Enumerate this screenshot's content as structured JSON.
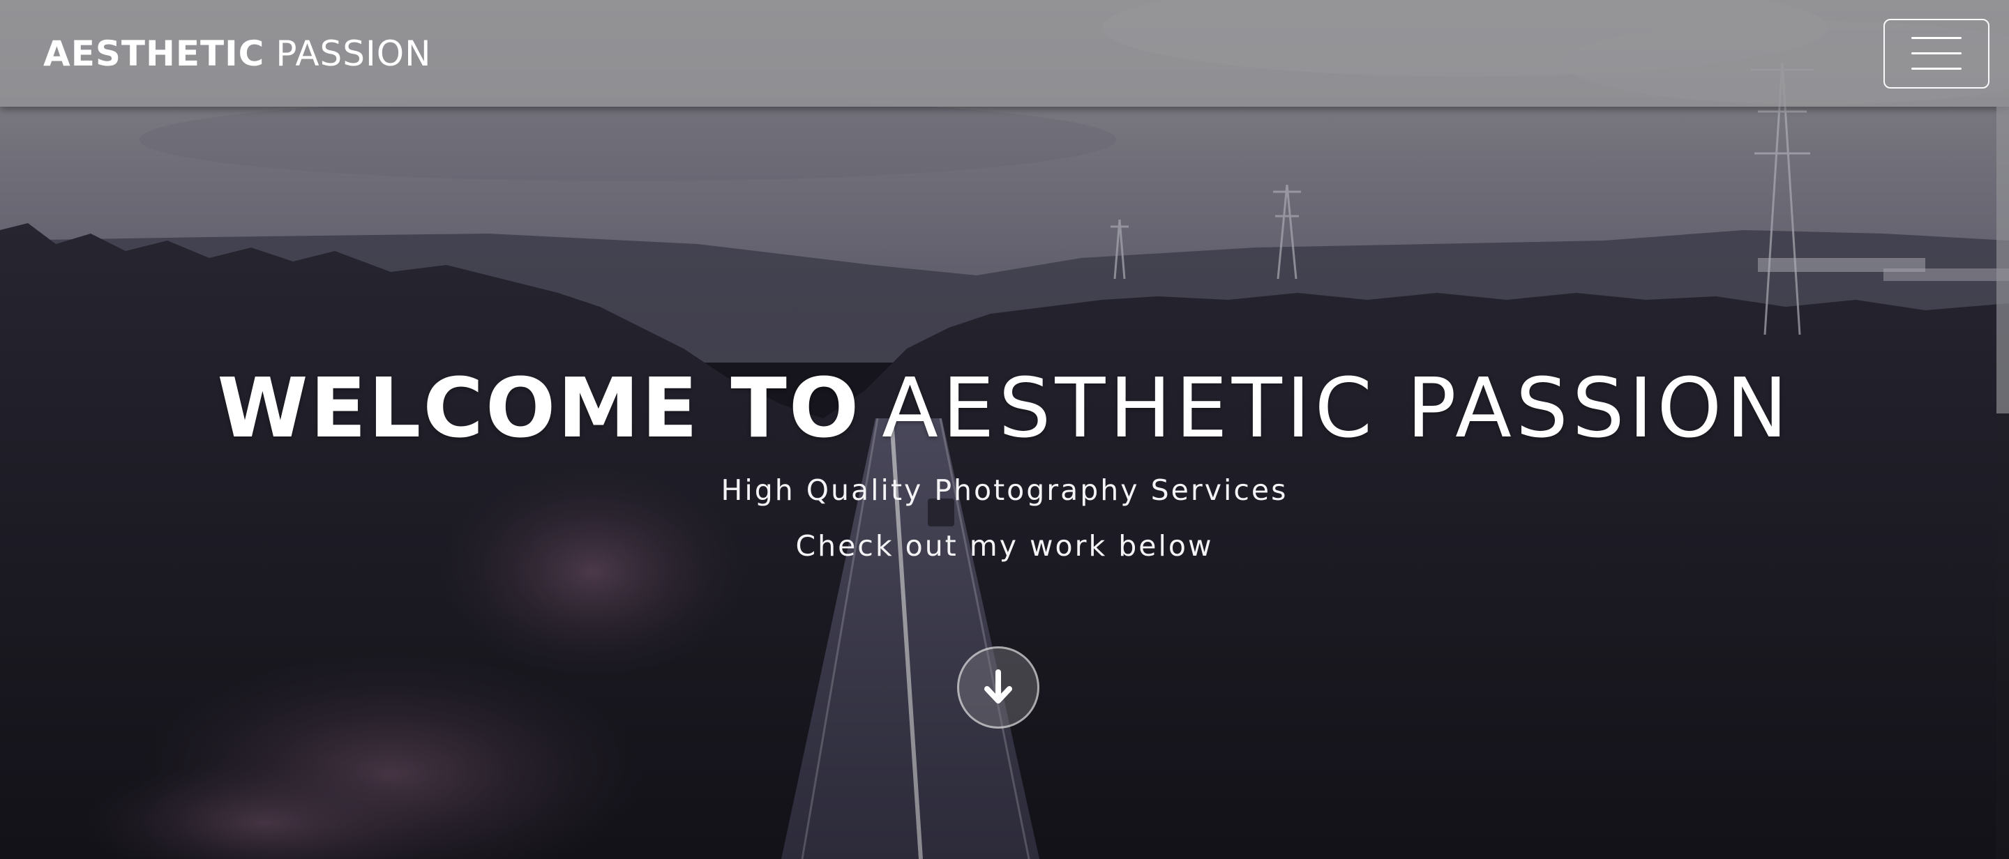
{
  "navbar": {
    "brand_bold": "AESTHETIC",
    "brand_light": "PASSION",
    "menu_icon": "hamburger-menu-icon"
  },
  "hero": {
    "title_bold": "WELCOME TO",
    "title_light": "AESTHETIC PASSION",
    "subtitle": "High Quality Photography Services",
    "tagline": "Check out my work below",
    "scroll_icon": "arrow-down-icon"
  },
  "colors": {
    "navbar_bg": "#969698",
    "text": "#ffffff",
    "sky": "#7d7e87",
    "forest": "#1c1b22"
  }
}
